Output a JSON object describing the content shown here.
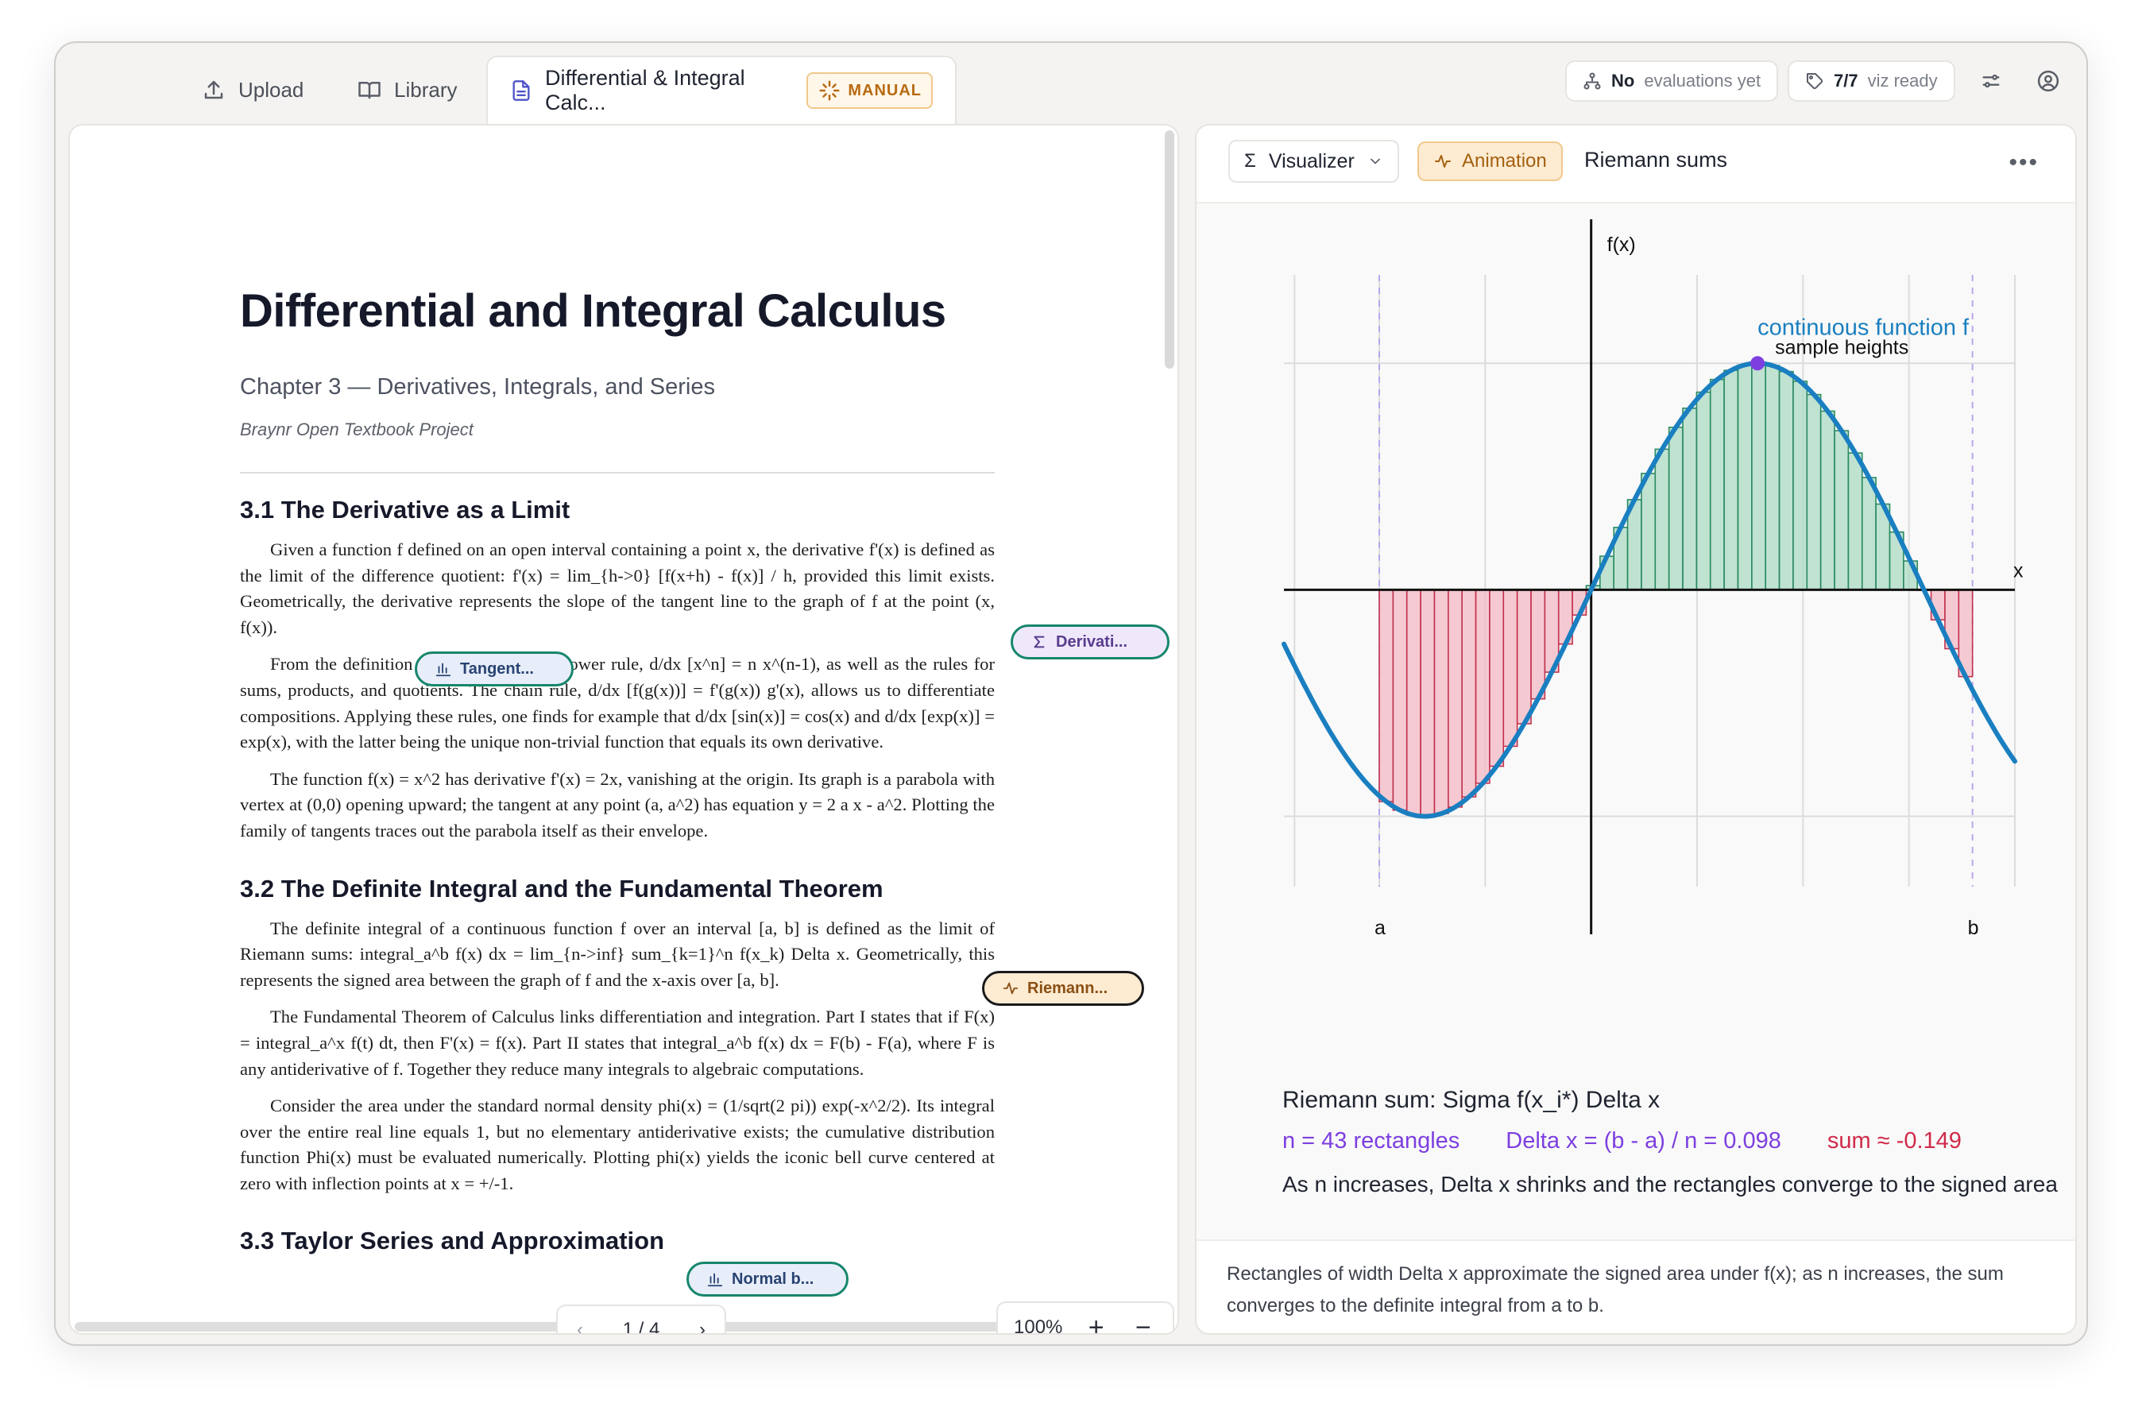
{
  "tabs": [
    {
      "label": "Upload",
      "icon": "upload-icon"
    },
    {
      "label": "Library",
      "icon": "book-icon"
    },
    {
      "label": "Differential & Integral Calc...",
      "icon": "document-icon",
      "badge": "MANUAL"
    }
  ],
  "status": {
    "evaluations_strong": "No",
    "evaluations_rest": "evaluations yet",
    "viz_count": "7/7",
    "viz_rest": "viz ready"
  },
  "doc": {
    "title": "Differential and Integral Calculus",
    "chapter": "Chapter 3 — Derivatives, Integrals, and Series",
    "source": "Braynr Open Textbook Project",
    "sections": [
      {
        "heading": "3.1  The Derivative as a Limit",
        "paragraphs": [
          "Given a function f defined on an open interval containing a point x, the derivative f'(x) is defined as the limit of the difference quotient: f'(x) = lim_{h->0} [f(x+h) - f(x)] / h, provided this limit exists. Geometrically, the derivative represents the slope of the tangent line to the graph of f at the point (x, f(x)).",
          "From the definition one can derive the power rule, d/dx [x^n] = n x^(n-1), as well as the rules for sums, products, and quotients. The chain rule, d/dx [f(g(x))] = f'(g(x)) g'(x), allows us to differentiate compositions. Applying these rules, one finds for example that d/dx [sin(x)] = cos(x) and d/dx [exp(x)] = exp(x), with the latter being the unique non-trivial function that equals its own derivative.",
          "The function f(x) = x^2 has derivative f'(x) = 2x, vanishing at the origin. Its graph is a parabola with vertex at (0,0) opening upward; the tangent at any point (a, a^2) has equation y = 2 a x - a^2. Plotting the family of tangents traces out the parabola itself as their envelope."
        ]
      },
      {
        "heading": "3.2  The Definite Integral and the Fundamental Theorem",
        "paragraphs": [
          "The definite integral of a continuous function f over an interval [a, b] is defined as the limit of Riemann sums: integral_a^b f(x) dx = lim_{n->inf} sum_{k=1}^n f(x_k) Delta x. Geometrically, this represents the signed area between the graph of f and the x-axis over [a, b].",
          "The Fundamental Theorem of Calculus links differentiation and integration. Part I states that if F(x) = integral_a^x f(t) dt, then F'(x) = f(x). Part II states that integral_a^b f(x) dx = F(b) - F(a), where F is any antiderivative of f. Together they reduce many integrals to algebraic computations.",
          "Consider the area under the standard normal density phi(x) = (1/sqrt(2 pi)) exp(-x^2/2). Its integral over the entire real line equals 1, but no elementary antiderivative exists; the cumulative distribution function Phi(x) must be evaluated numerically. Plotting phi(x) yields the iconic bell curve centered at zero with inflection points at x = +/-1."
        ]
      },
      {
        "heading": "3.3  Taylor Series and Approximation",
        "paragraphs": []
      }
    ],
    "chips": {
      "tangent": "Tangent...",
      "derivative": "Derivati...",
      "riemann": "Riemann...",
      "normal": "Normal b..."
    },
    "page_indicator": "1 / 4",
    "zoom": "100%"
  },
  "viz": {
    "dropdown_label": "Visualizer",
    "mode_label": "Animation",
    "name": "Riemann sums",
    "more": "•••",
    "plot": {
      "y_axis_label": "f(x)",
      "x_axis_label": "x",
      "a_label": "a",
      "b_label": "b",
      "curve_label": "continuous function f",
      "point_label": "sample heights",
      "n_rectangles": 43,
      "a": -1.0,
      "b": 1.8,
      "x_range": [
        -1.45,
        2.0
      ],
      "y_range": [
        -1.1,
        1.25
      ],
      "colors": {
        "curve": "#1a7fc0",
        "positive_fill": "#a6d9c0",
        "positive_stroke": "#2b8a62",
        "negative_fill": "#f4b5c2",
        "negative_stroke": "#c2344f",
        "sample_point": "#7d3fe0",
        "ab_guides": "#b9a6ec"
      }
    },
    "sum_heading": "Riemann sum: Sigma f(x_i*) Delta x",
    "n_text": "n = 43 rectangles",
    "dx_text": "Delta x = (b - a) / n = 0.098",
    "sum_text": "sum ≈ -0.149",
    "convergence_note": "As n increases, Delta x shrinks and the rectangles converge to the signed area",
    "caption": "Rectangles of width Delta x approximate the signed area under f(x); as n increases, the sum converges to the definite integral from a to b.",
    "text_colors": {
      "n": "#7d3fe0",
      "dx": "#7d3fe0",
      "sum": "#d02a4a"
    }
  }
}
